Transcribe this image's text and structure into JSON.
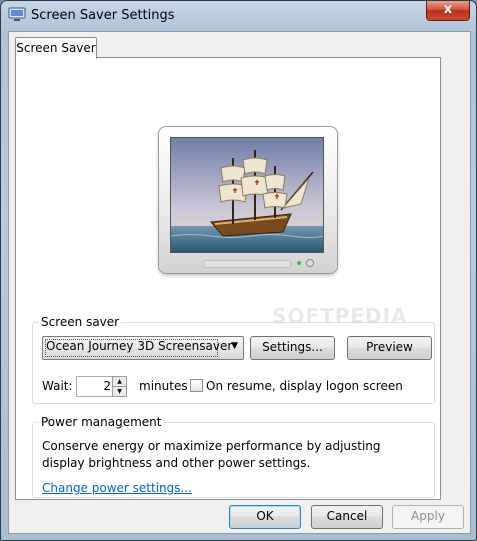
{
  "window": {
    "title": "Screen Saver Settings",
    "close_label": "x"
  },
  "tabs": [
    {
      "label": "Screen Saver"
    }
  ],
  "screen_saver": {
    "group_label": "Screen saver",
    "selected": "Ocean Journey 3D Screensaver",
    "settings_label": "Settings...",
    "preview_label": "Preview",
    "wait_label": "Wait:",
    "wait_value": "2",
    "minutes_label": "minutes",
    "resume_label": "On resume, display logon screen",
    "resume_checked": false
  },
  "power": {
    "group_label": "Power management",
    "description": "Conserve energy or maximize performance by adjusting display brightness and other power settings.",
    "link_label": "Change power settings..."
  },
  "footer": {
    "ok_label": "OK",
    "cancel_label": "Cancel",
    "apply_label": "Apply"
  },
  "watermark": "SOFTPEDIA",
  "colors": {
    "link": "#0066cc",
    "close": "#c94a33"
  }
}
